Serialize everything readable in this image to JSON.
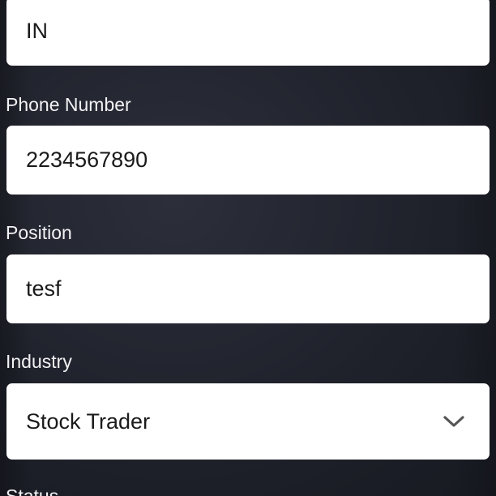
{
  "form": {
    "country": {
      "value": "IN"
    },
    "phone": {
      "label": "Phone Number",
      "value": "2234567890"
    },
    "position": {
      "label": "Position",
      "value": "tesf"
    },
    "industry": {
      "label": "Industry",
      "value": "Stock Trader",
      "icon": "chevron-down-icon"
    },
    "status": {
      "label": "Status"
    }
  },
  "colors": {
    "background": "#1f212b",
    "field_background": "#ffffff",
    "label_text": "#f2f2f4",
    "field_text": "#1a1a1a",
    "chevron": "#555555"
  }
}
